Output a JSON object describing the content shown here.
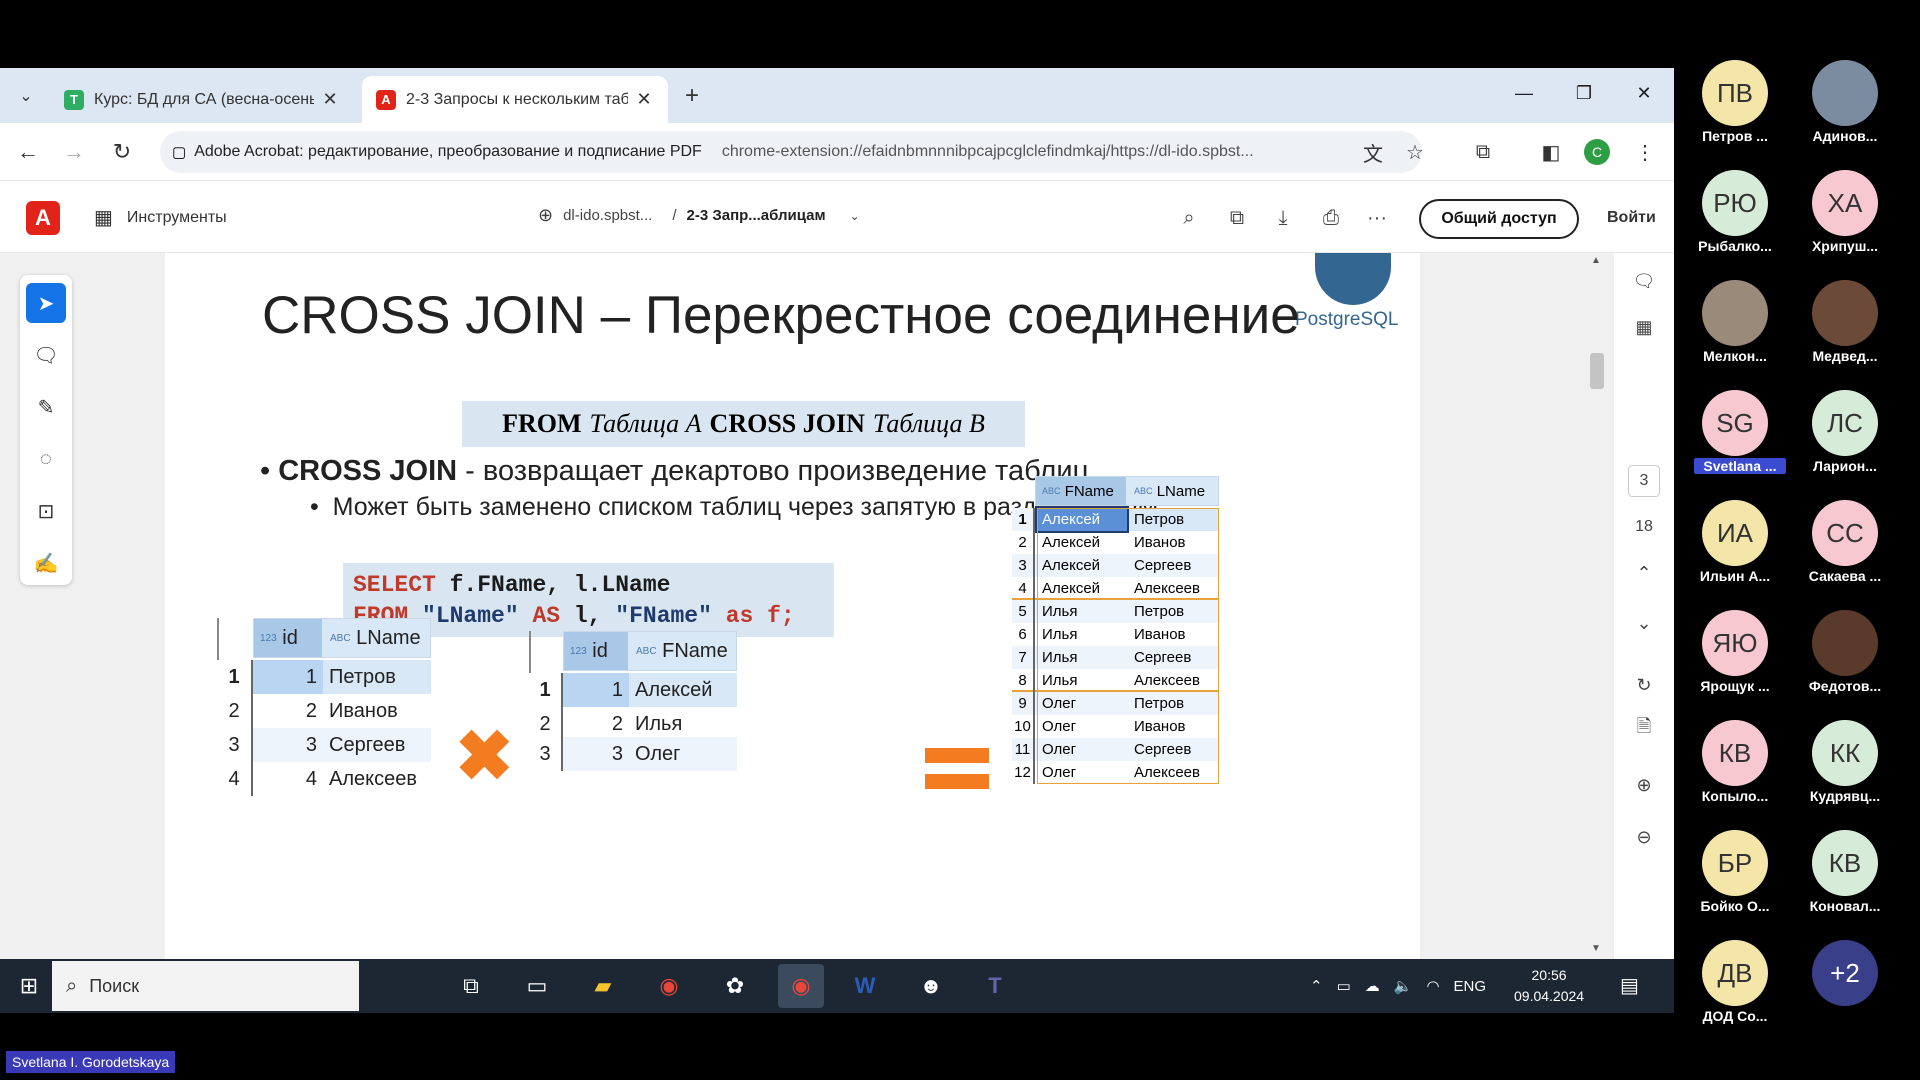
{
  "browser": {
    "tabs": [
      {
        "title": "Курс: БД для СА (весна-осень"
      },
      {
        "title": "2-3 Запросы к нескольким таб"
      }
    ],
    "new_tab": "+",
    "site_label": "Adobe Acrobat: редактирование, преобразование и подписание PDF",
    "url": "chrome-extension://efaidnbmnnnibpcajpcglclefindmkaj/https://dl-ido.spbst..."
  },
  "acrobat": {
    "tools_label": "Инструменты",
    "crumb_site": "dl-ido.spbst...",
    "crumb_sep": "/",
    "crumb_doc": "2-3 Запр...аблицам",
    "share_label": "Общий доступ",
    "login_label": "Войти",
    "page_current": "3",
    "page_total": "18"
  },
  "slide": {
    "title": "CROSS JOIN – Перекрестное соединение",
    "logo_text": "PostgreSQL",
    "from_parts": {
      "from": "FROM",
      "ta": "Таблица А",
      "cj": "CROSS JOIN",
      "tb": "Таблица В"
    },
    "bullet1_bold": "CROSS JOIN",
    "bullet1_rest": " - возвращает декартово произведение таблиц",
    "bullet2": "Может быть заменено списком таблиц через запятую в разделе FROM",
    "sql": {
      "l1_kw": "SELECT",
      "l1_rest": " f.FName, l.LName",
      "l2_kw1": "FROM",
      "l2_s1": " \"LName\"",
      "l2_kw2": " AS",
      "l2_mid": " l, ",
      "l2_s2": "\"FName\"",
      "l2_kw3": " as",
      "l2_end": " f;"
    },
    "table_lname": {
      "headers": [
        "id",
        "LName"
      ],
      "rows": [
        {
          "n": "1",
          "id": "1",
          "val": "Петров"
        },
        {
          "n": "2",
          "id": "2",
          "val": "Иванов"
        },
        {
          "n": "3",
          "id": "3",
          "val": "Сергеев"
        },
        {
          "n": "4",
          "id": "4",
          "val": "Алексеев"
        }
      ]
    },
    "table_fname": {
      "headers": [
        "id",
        "FName"
      ],
      "rows": [
        {
          "n": "1",
          "id": "1",
          "val": "Алексей"
        },
        {
          "n": "2",
          "id": "2",
          "val": "Илья"
        },
        {
          "n": "3",
          "id": "3",
          "val": "Олег"
        }
      ]
    },
    "result": {
      "headers": [
        "FName",
        "LName"
      ],
      "rows": [
        {
          "n": "1",
          "f": "Алексей",
          "l": "Петров"
        },
        {
          "n": "2",
          "f": "Алексей",
          "l": "Иванов"
        },
        {
          "n": "3",
          "f": "Алексей",
          "l": "Сергеев"
        },
        {
          "n": "4",
          "f": "Алексей",
          "l": "Алексеев"
        },
        {
          "n": "5",
          "f": "Илья",
          "l": "Петров"
        },
        {
          "n": "6",
          "f": "Илья",
          "l": "Иванов"
        },
        {
          "n": "7",
          "f": "Илья",
          "l": "Сергеев"
        },
        {
          "n": "8",
          "f": "Илья",
          "l": "Алексеев"
        },
        {
          "n": "9",
          "f": "Олег",
          "l": "Петров"
        },
        {
          "n": "10",
          "f": "Олег",
          "l": "Иванов"
        },
        {
          "n": "11",
          "f": "Олег",
          "l": "Сергеев"
        },
        {
          "n": "12",
          "f": "Олег",
          "l": "Алексеев"
        }
      ]
    }
  },
  "taskbar": {
    "search_placeholder": "Поиск",
    "lang": "ENG",
    "time": "20:56",
    "date": "09.04.2024"
  },
  "participants": [
    {
      "initials": "ПВ",
      "name": "Петров ...",
      "color": "#f4e6a8"
    },
    {
      "initials": "",
      "name": "Адинов...",
      "color": "#7c8ca0"
    },
    {
      "initials": "РЮ",
      "name": "Рыбалко...",
      "color": "#d6ecd8"
    },
    {
      "initials": "ХА",
      "name": "Хрипуш...",
      "color": "#f7c8cf"
    },
    {
      "initials": "",
      "name": "Мелкон...",
      "color": "#9a8a7a"
    },
    {
      "initials": "",
      "name": "Медвед...",
      "color": "#6b4a3a"
    },
    {
      "initials": "SG",
      "name": "Svetlana ...",
      "color": "#f7c8cf"
    },
    {
      "initials": "ЛС",
      "name": "Ларион...",
      "color": "#d6ecd8"
    },
    {
      "initials": "ИА",
      "name": "Ильин А...",
      "color": "#f4e6a8"
    },
    {
      "initials": "СС",
      "name": "Сакаева ...",
      "color": "#f7c8cf"
    },
    {
      "initials": "ЯЮ",
      "name": "Ярощук ...",
      "color": "#f7c8cf"
    },
    {
      "initials": "",
      "name": "Федотов...",
      "color": "#5a3a2a"
    },
    {
      "initials": "КВ",
      "name": "Копыло...",
      "color": "#f7c8cf"
    },
    {
      "initials": "КК",
      "name": "Кудрявц...",
      "color": "#d6ecd8"
    },
    {
      "initials": "БР",
      "name": "Бойко О...",
      "color": "#f4e6a8"
    },
    {
      "initials": "КВ",
      "name": "Коновал...",
      "color": "#d6ecd8"
    },
    {
      "initials": "ДВ",
      "name": "ДОД Со...",
      "color": "#f4e6a8"
    },
    {
      "initials": "+2",
      "name": "",
      "color": "#3a3f8a"
    }
  ],
  "presenter": "Svetlana I. Gorodetskaya"
}
